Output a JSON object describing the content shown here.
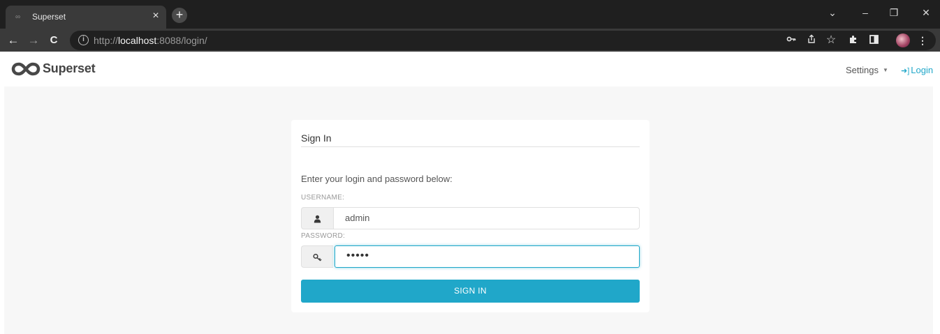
{
  "browser": {
    "tab": {
      "title": "Superset",
      "close_glyph": "×"
    },
    "new_tab_glyph": "+",
    "window_controls": {
      "dropdown": "⌄",
      "minimize": "–",
      "restore": "❐",
      "close": "✕"
    },
    "nav": {
      "back": "←",
      "forward": "→",
      "reload": "C"
    },
    "address": {
      "scheme": "http://",
      "host": "localhost",
      "rest": ":8088/login/"
    },
    "toolbar_icons": [
      "key-icon",
      "share-icon",
      "star-icon",
      "extensions-icon",
      "sidepanel-icon",
      "profile-avatar",
      "menu-icon"
    ]
  },
  "app_nav": {
    "brand": "Superset",
    "settings_label": "Settings",
    "login_label": "Login",
    "brand_color": "#484848",
    "link_color": "#20a7c9"
  },
  "login_form": {
    "title": "Sign In",
    "prompt": "Enter your login and password below:",
    "username_label": "USERNAME:",
    "username_value": "admin",
    "password_label": "PASSWORD:",
    "password_value": "•••••",
    "submit_label": "SIGN IN",
    "accent_color": "#20a7c9"
  }
}
